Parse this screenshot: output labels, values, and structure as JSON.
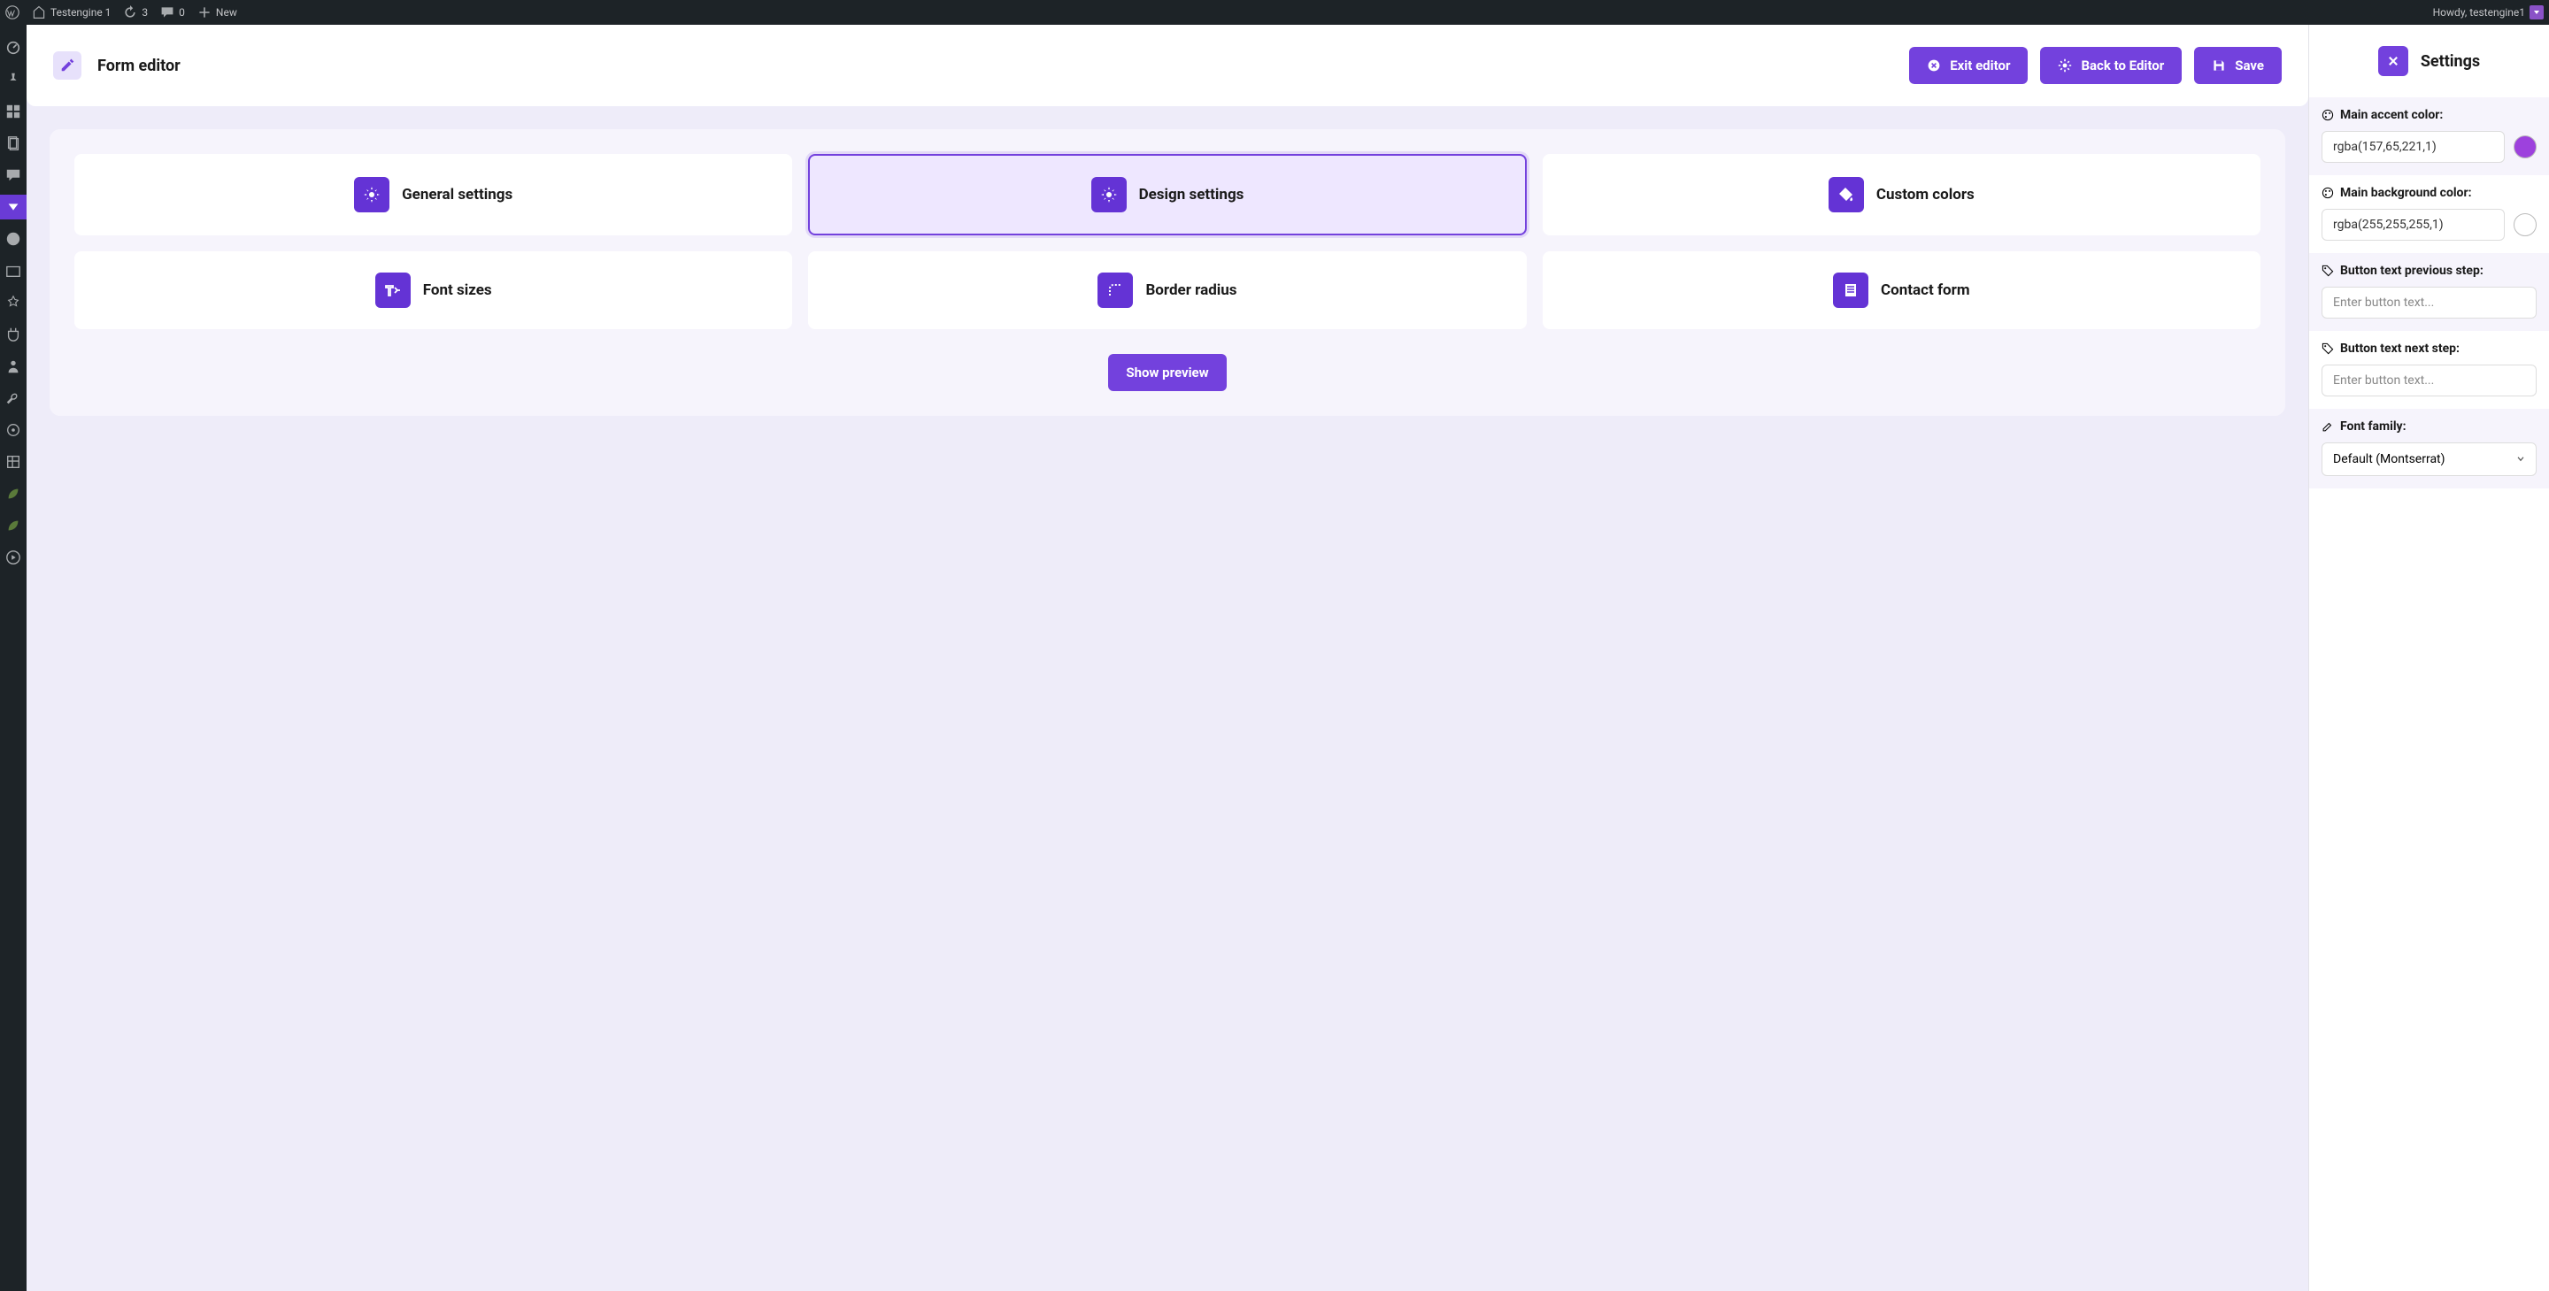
{
  "adminbar": {
    "site_name": "Testengine 1",
    "updates_count": "3",
    "comments_count": "0",
    "new_label": "New",
    "howdy": "Howdy, testengine1"
  },
  "header": {
    "title": "Form editor",
    "exit_label": "Exit editor",
    "back_label": "Back to Editor",
    "save_label": "Save"
  },
  "cards": {
    "general": "General settings",
    "design": "Design settings",
    "custom_colors": "Custom colors",
    "font_sizes": "Font sizes",
    "border_radius": "Border radius",
    "contact_form": "Contact form",
    "show_preview": "Show preview"
  },
  "settings": {
    "title": "Settings",
    "accent_label": "Main accent color:",
    "accent_value": "rgba(157,65,221,1)",
    "accent_swatch": "#9d41dd",
    "bg_label": "Main background color:",
    "bg_value": "rgba(255,255,255,1)",
    "bg_swatch": "#ffffff",
    "prev_label": "Button text previous step:",
    "prev_placeholder": "Enter button text...",
    "next_label": "Button text next step:",
    "next_placeholder": "Enter button text...",
    "font_label": "Font family:",
    "font_value": "Default (Montserrat)"
  }
}
